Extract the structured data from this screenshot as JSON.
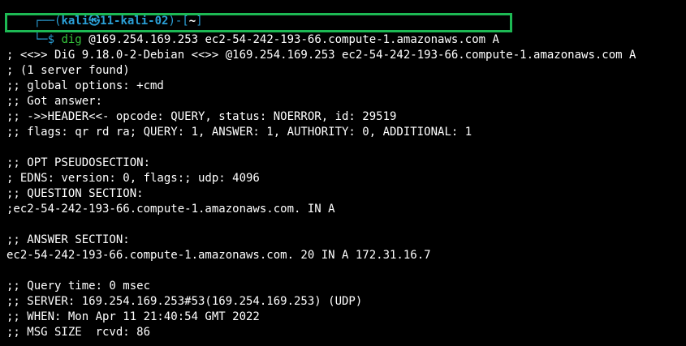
{
  "prompt": {
    "corner_top": "┌──(",
    "user": "kali",
    "at_symbol": "㉿",
    "host": "11-kali-02",
    "sep": ")-[",
    "path": "~",
    "close": "]",
    "corner_bottom": "└─",
    "dollar": "$",
    "command": "dig",
    "args": "@169.254.169.253 ec2-54-242-193-66.compute-1.amazonaws.com A"
  },
  "output": [
    "; <<>> DiG 9.18.0-2-Debian <<>> @169.254.169.253 ec2-54-242-193-66.compute-1.amazonaws.com A",
    "; (1 server found)",
    ";; global options: +cmd",
    ";; Got answer:",
    ";; ->>HEADER<<- opcode: QUERY, status: NOERROR, id: 29519",
    ";; flags: qr rd ra; QUERY: 1, ANSWER: 1, AUTHORITY: 0, ADDITIONAL: 1",
    "",
    ";; OPT PSEUDOSECTION:",
    "; EDNS: version: 0, flags:; udp: 4096",
    ";; QUESTION SECTION:",
    ";ec2-54-242-193-66.compute-1.amazonaws.com. IN A",
    "",
    ";; ANSWER SECTION:",
    "ec2-54-242-193-66.compute-1.amazonaws.com. 20 IN A 172.31.16.7",
    "",
    ";; Query time: 0 msec",
    ";; SERVER: 169.254.169.253#53(169.254.169.253) (UDP)",
    ";; WHEN: Mon Apr 11 21:40:54 GMT 2022",
    ";; MSG SIZE  rcvd: 86"
  ],
  "colors": {
    "background": "#000000",
    "prompt_blue": "#2a9fd6",
    "command_green": "#35c43c",
    "highlight_border": "#1db954",
    "text": "#ffffff"
  }
}
